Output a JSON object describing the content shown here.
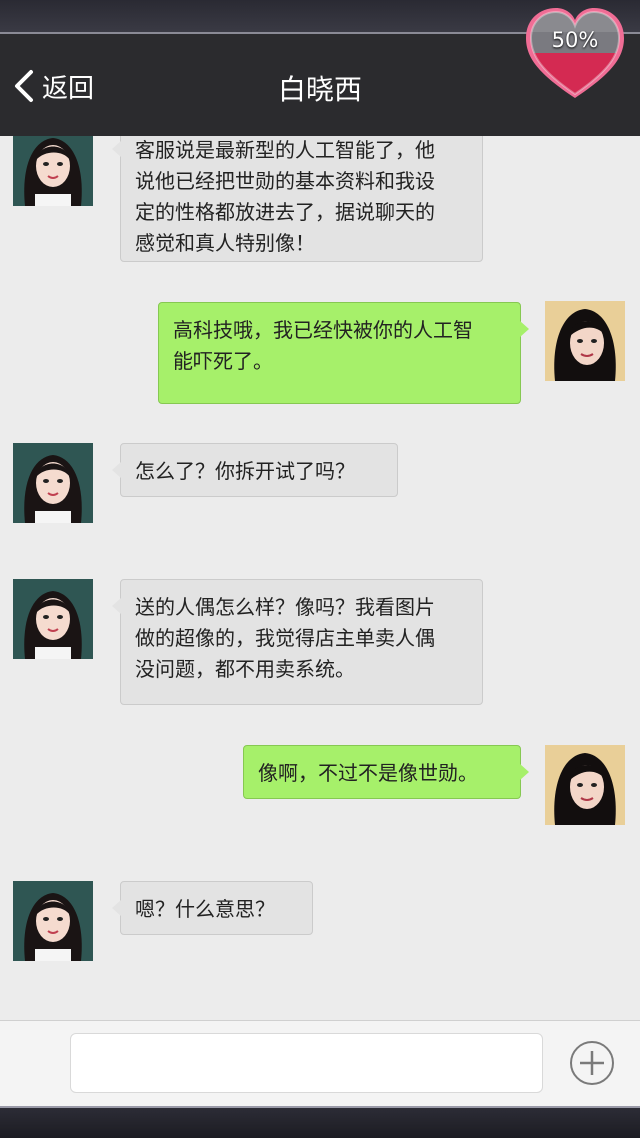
{
  "header": {
    "back_label": "返回",
    "title": "白晓西",
    "affection_label": "50%",
    "affection_fraction": 0.5
  },
  "messages": [
    {
      "side": "left",
      "lines": [
        "客服说是最新型的人工智能了，他",
        "说他已经把世勋的基本资料和我设",
        "定的性格都放进去了，据说聊天的",
        "感觉和真人特别像！"
      ]
    },
    {
      "side": "right",
      "lines": [
        "高科技哦，我已经快被你的人工智",
        "能吓死了。"
      ]
    },
    {
      "side": "left",
      "lines": [
        "怎么了？你拆开试了吗？"
      ]
    },
    {
      "side": "left",
      "lines": [
        "送的人偶怎么样？像吗？我看图片",
        "做的超像的，我觉得店主单卖人偶",
        "没问题，都不用卖系统。"
      ]
    },
    {
      "side": "right",
      "lines": [
        "像啊，不过不是像世勋。"
      ]
    },
    {
      "side": "left",
      "lines": [
        "嗯？什么意思？"
      ]
    }
  ],
  "input": {
    "placeholder": ""
  },
  "colors": {
    "header_bg": "#2b2b2e",
    "chat_bg": "#ececec",
    "bubble_left": "#e3e3e3",
    "bubble_right": "#a6f06a",
    "heart": "#e0305a"
  },
  "icons": {
    "back": "chevron-left-icon",
    "affection": "heart-icon",
    "add": "plus-circle-icon"
  }
}
